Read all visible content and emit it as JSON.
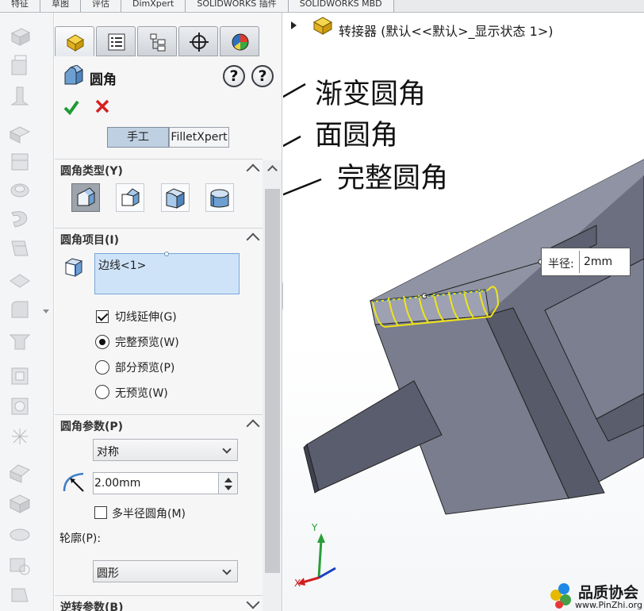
{
  "top_tabs": [
    "特征",
    "草图",
    "评估",
    "DimXpert",
    "SOLIDWORKS 插件",
    "SOLIDWORKS MBD"
  ],
  "property_manager": {
    "title": "圆角",
    "mode_manual": "手工",
    "mode_filletxpert": "FilletXpert",
    "sections": {
      "fillet_type": "圆角类型(Y)",
      "fillet_items": "圆角项目(I)",
      "fillet_params": "圆角参数(P)",
      "reverse_params": "逆转参数(B)"
    },
    "edge_selection": "边线<1>",
    "options": {
      "tangent_propagation": "切线延伸(G)",
      "full_preview": "完整预览(W)",
      "partial_preview": "部分预览(P)",
      "no_preview": "无预览(W)",
      "preview_selected": "full_preview"
    },
    "symmetry_mode": "对称",
    "radius_value": "2.00mm",
    "multi_radius": "多半径圆角(M)",
    "multi_radius_checked": false,
    "tangent_checked": true,
    "profile_label": "轮廓(P):",
    "profile_value": "圆形",
    "help_label": "?"
  },
  "viewport": {
    "tree_root": "转接器 (默认<<默认>_显示状态 1>)",
    "annotations": {
      "variable_fillet": "渐变圆角",
      "face_fillet": "面圆角",
      "full_round_fillet": "完整圆角"
    },
    "callout_label": "半径:",
    "callout_value": "2mm",
    "triad": {
      "x": "X",
      "y": "Y"
    },
    "watermark_main": "品质协会",
    "watermark_url": "www.PinZhi.org"
  },
  "colors": {
    "part_dark": "#4a4d5c",
    "part_face": "#6e7182",
    "part_light": "#9c9fad",
    "fillet_preview": "#f0e418",
    "selection_highlight": "#bfd0e2"
  }
}
